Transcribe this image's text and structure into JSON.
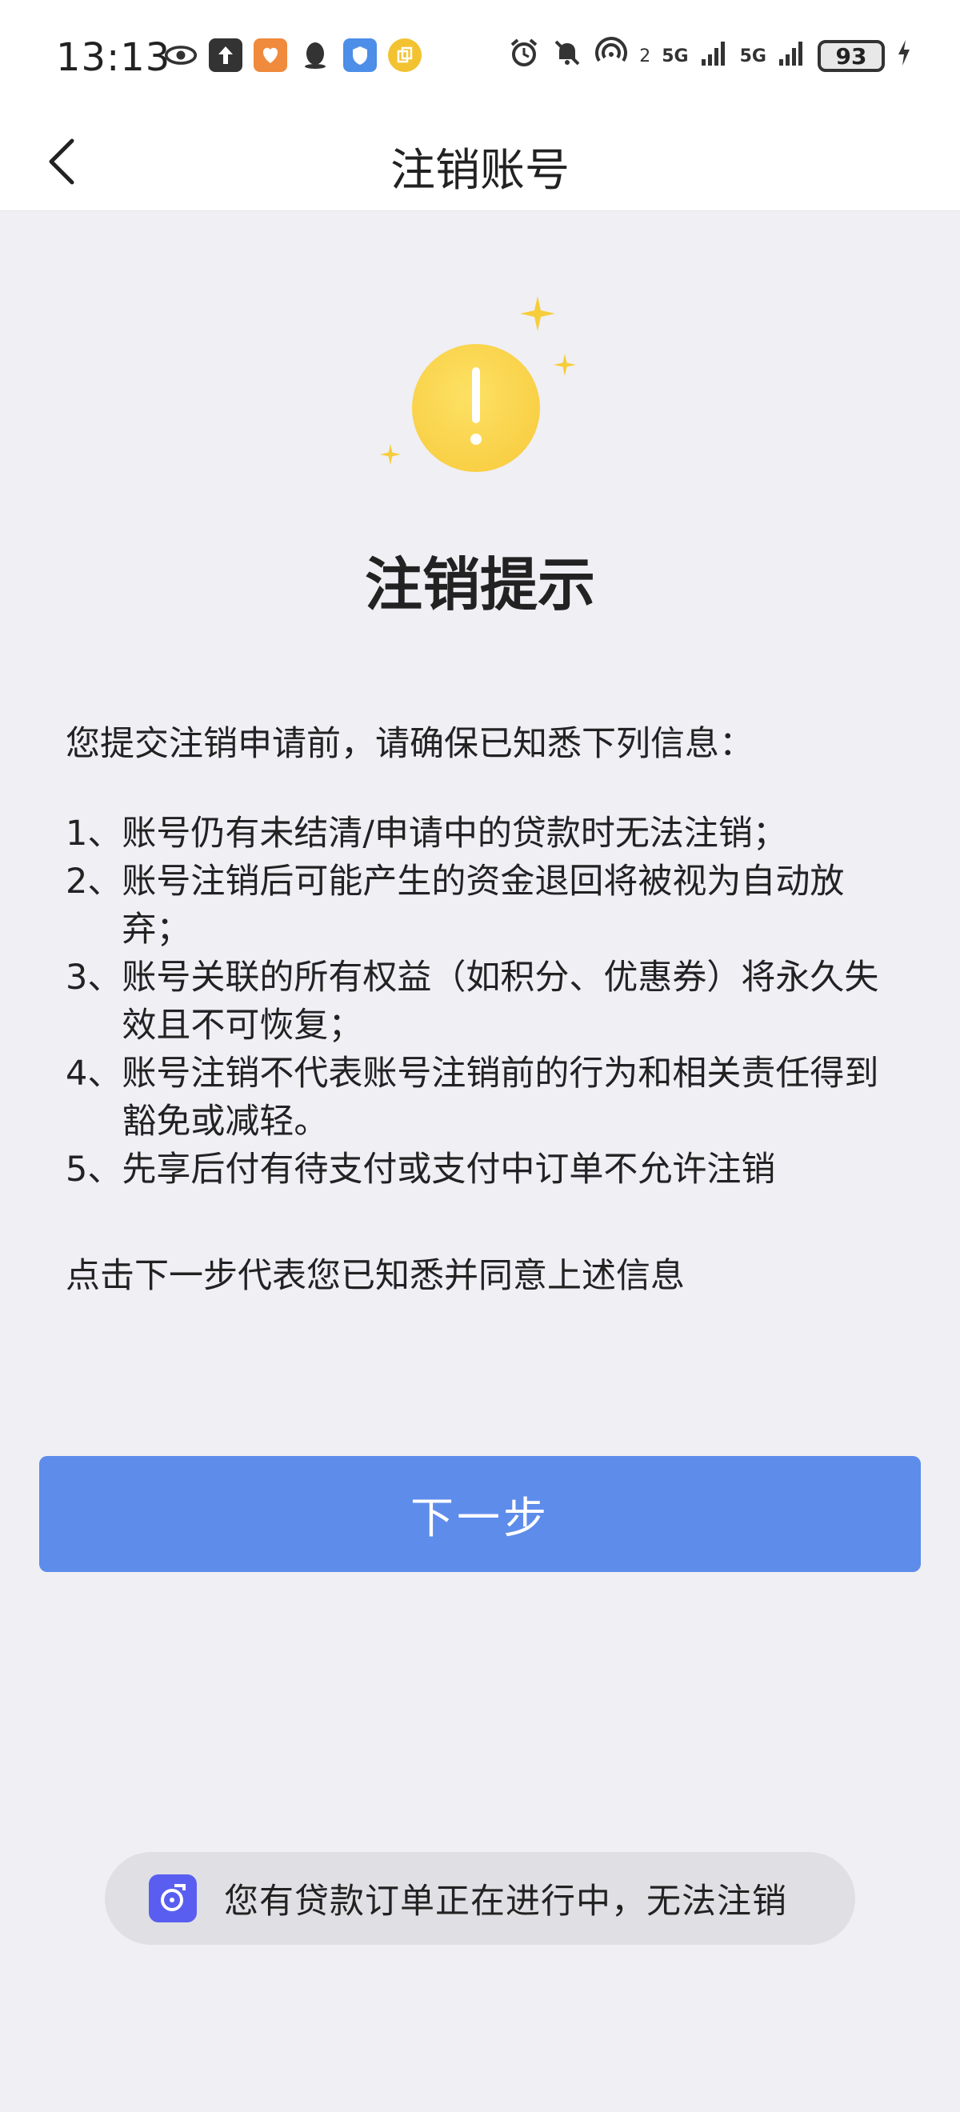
{
  "status_bar": {
    "time": "13:13",
    "network_1": "2",
    "network_2": "5G",
    "network_3": "5G",
    "battery": "93"
  },
  "nav": {
    "title": "注销账号"
  },
  "hero": {
    "title": "注销提示"
  },
  "notice": {
    "intro": "您提交注销申请前，请确保已知悉下列信息：",
    "items": [
      {
        "num": "1、",
        "text": "账号仍有未结清/申请中的贷款时无法注销；"
      },
      {
        "num": "2、",
        "text": "账号注销后可能产生的资金退回将被视为自动放弃；"
      },
      {
        "num": "3、",
        "text": "账号关联的所有权益（如积分、优惠券）将永久失效且不可恢复；"
      },
      {
        "num": "4、",
        "text": "账号注销不代表账号注销前的行为和相关责任得到豁免或减轻。"
      },
      {
        "num": "5、",
        "text": "先享后付有待支付或支付中订单不允许注销"
      }
    ],
    "footer": "点击下一步代表您已知悉并同意上述信息"
  },
  "actions": {
    "next_label": "下一步"
  },
  "toast": {
    "message": "您有贷款订单正在进行中，无法注销"
  },
  "colors": {
    "primary_button": "#5e8ceb",
    "warning": "#f7c93a",
    "background": "#efeff4"
  }
}
